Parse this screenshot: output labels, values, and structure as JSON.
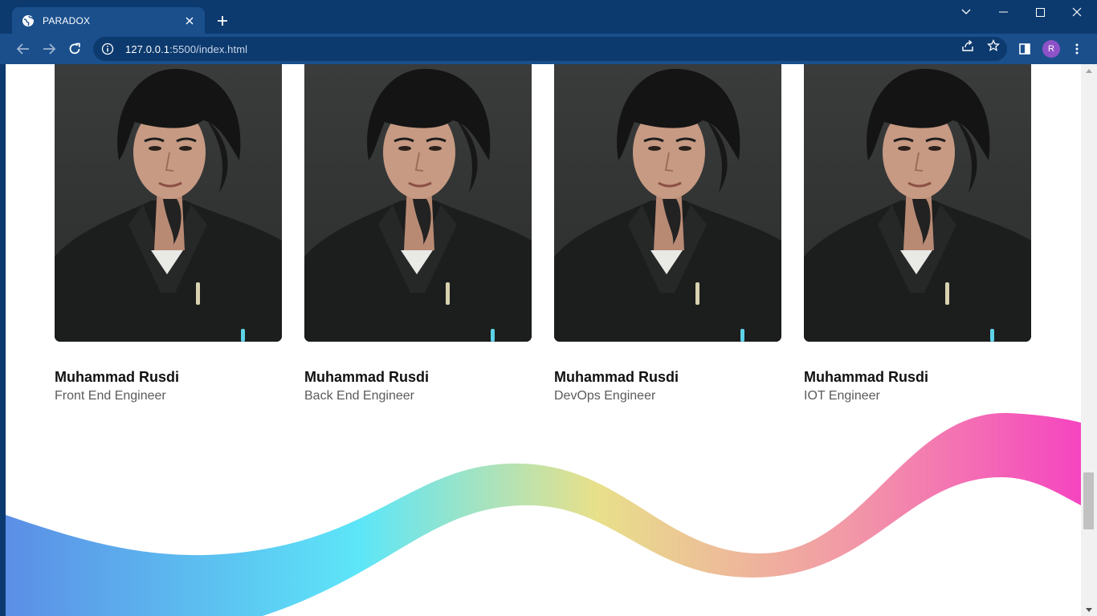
{
  "browser": {
    "tab_title": "PARADOX",
    "url_host": "127.0.0.1",
    "url_rest": ":5500/index.html",
    "profile_initial": "R",
    "icons": [
      "globe-icon",
      "close-icon",
      "plus-icon",
      "chevron-down-icon",
      "minimize-icon",
      "maximize-icon",
      "close-window-icon",
      "back-arrow-icon",
      "forward-arrow-icon",
      "reload-icon",
      "info-icon",
      "share-icon",
      "star-icon",
      "sidepanel-icon",
      "kebab-menu-icon"
    ]
  },
  "team": {
    "members": [
      {
        "name": "Muhammad Rusdi",
        "role": "Front End Engineer"
      },
      {
        "name": "Muhammad Rusdi",
        "role": "Back End Engineer"
      },
      {
        "name": "Muhammad Rusdi",
        "role": "DevOps Engineer"
      },
      {
        "name": "Muhammad Rusdi",
        "role": "IOT Engineer"
      }
    ]
  },
  "colors": {
    "chrome_dark": "#0d3a6e",
    "chrome_light": "#1a4f8c",
    "wave_gradient": [
      "#5b8ee6",
      "#5de6f8",
      "#e8e08a",
      "#f29aa6",
      "#f545c0"
    ]
  }
}
